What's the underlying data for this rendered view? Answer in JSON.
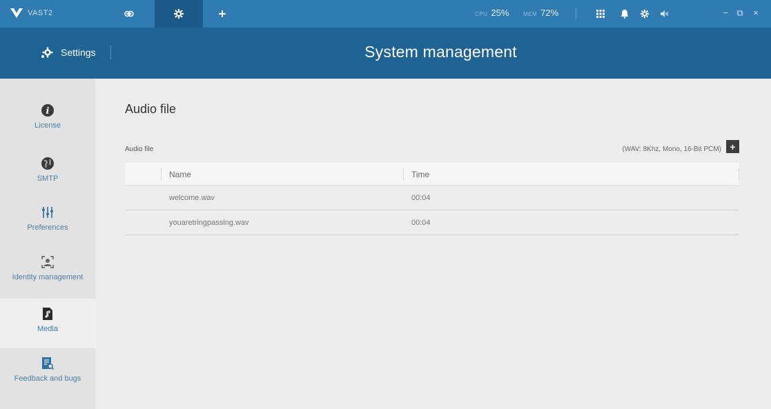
{
  "app": {
    "name": "VAST2",
    "brand_color": "#2f7bb2",
    "header_color": "#1f6394"
  },
  "topbar": {
    "tabs": [
      {
        "icon": "eye-icon"
      },
      {
        "icon": "gear-icon"
      },
      {
        "icon": "plus-icon"
      }
    ],
    "cpu": {
      "label": "CPU",
      "value": "25%"
    },
    "mem": {
      "label": "MEM",
      "value": "72%"
    },
    "icons": [
      "grid-icon",
      "bell-icon",
      "settings-icon",
      "speaker-icon"
    ],
    "window_controls": [
      "−",
      "⧉",
      "×"
    ]
  },
  "header": {
    "section": "Settings",
    "title": "System management"
  },
  "sidebar": {
    "items": [
      {
        "label": "License",
        "icon": "info-icon"
      },
      {
        "label": "SMTP",
        "icon": "globe-icon"
      },
      {
        "label": "Preferences",
        "icon": "sliders-icon"
      },
      {
        "label": "Identity management",
        "icon": "identity-icon"
      },
      {
        "label": "Media",
        "icon": "media-file-icon",
        "active": true
      },
      {
        "label": "Feedback and bugs",
        "icon": "feedback-icon"
      }
    ]
  },
  "main": {
    "title": "Audio file",
    "section_label": "Audio file",
    "format_hint": "(WAV: 8Khz, Mono, 16-Bit PCM)",
    "add_label": "+",
    "columns": {
      "name": "Name",
      "time": "Time"
    },
    "rows": [
      {
        "name": "welcome.wav",
        "time": "00:04"
      },
      {
        "name": "youaretringpassing.wav",
        "time": "00:04"
      }
    ]
  }
}
